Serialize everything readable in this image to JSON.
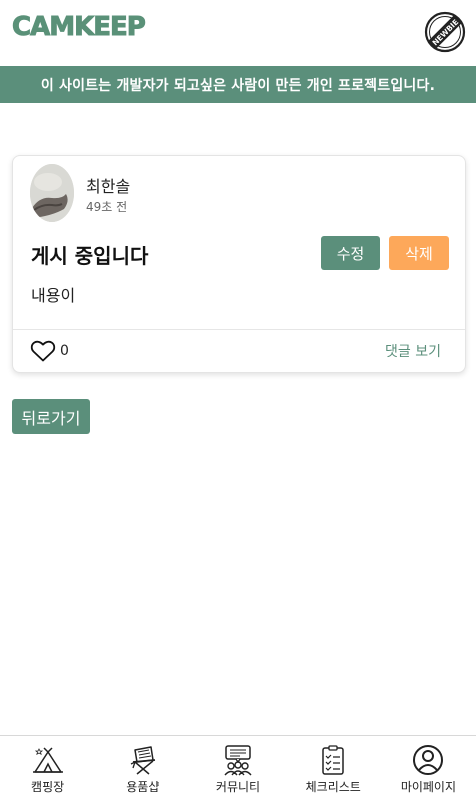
{
  "header": {
    "logo_text": "CAMKEEP",
    "badge_text": "NEWBIE",
    "logo_color": "#5a9178"
  },
  "notice": {
    "text": "이 사이트는 개발자가 되고싶은 사람이 만든 개인 프로젝트입니다."
  },
  "post": {
    "author": "최한솔",
    "time": "49초 전",
    "title": "게시 중입니다",
    "content": "내용이",
    "edit_label": "수정",
    "delete_label": "삭제",
    "like_count": "0",
    "comments_label": "댓글 보기"
  },
  "actions": {
    "back_label": "뒤로가기"
  },
  "nav": {
    "items": [
      {
        "label": "캠핑장",
        "icon": "tent-icon"
      },
      {
        "label": "용품샵",
        "icon": "camping-chair-icon"
      },
      {
        "label": "커뮤니티",
        "icon": "community-icon"
      },
      {
        "label": "체크리스트",
        "icon": "checklist-icon"
      },
      {
        "label": "마이페이지",
        "icon": "user-icon"
      }
    ]
  },
  "colors": {
    "primary": "#5b8f7b",
    "delete": "#fda85a",
    "notice_bg": "#5b8f7b"
  }
}
